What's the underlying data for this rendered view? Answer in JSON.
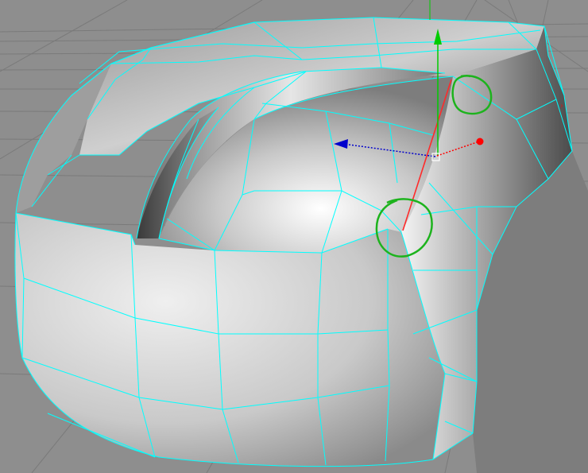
{
  "viewport": {
    "name": "perspective-viewport",
    "background_color": "#8e8e8e",
    "grid_color": "#7a7a7a",
    "wireframe_color": "#00ffff",
    "surface_colors": {
      "highlight": "#ffffff",
      "mid": "#c4c4c4",
      "shadow": "#5a5a5a"
    }
  },
  "model": {
    "name": "subdivision-surface-mesh",
    "selected_edge_color": "#ff2a2a"
  },
  "gizmo": {
    "name": "move-manipulator",
    "axes": [
      {
        "axis": "x",
        "color": "#ff0000"
      },
      {
        "axis": "y",
        "color": "#00cc00"
      },
      {
        "axis": "z",
        "color": "#0000cc"
      }
    ]
  },
  "annotations": [
    {
      "name": "highlight-circle-upper",
      "color": "#1db31d"
    },
    {
      "name": "highlight-circle-lower",
      "color": "#1db31d"
    }
  ]
}
